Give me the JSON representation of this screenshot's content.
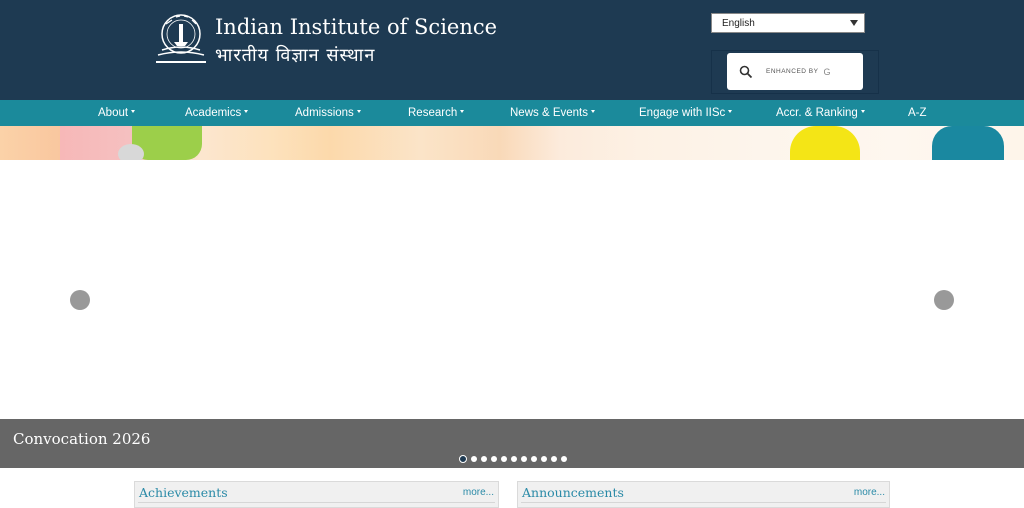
{
  "header": {
    "title_en": "Indian Institute of Science",
    "title_hi": "भारतीय  विज्ञान  संस्थान",
    "logo_icon": "iisc-logo-icon"
  },
  "language": {
    "selected": "English"
  },
  "search": {
    "enhanced_label": "ENHANCED BY",
    "g_glyph": "G"
  },
  "nav": {
    "items": [
      {
        "label": "About",
        "has_caret": true
      },
      {
        "label": "Academics",
        "has_caret": true
      },
      {
        "label": "Admissions",
        "has_caret": true
      },
      {
        "label": "Research",
        "has_caret": true
      },
      {
        "label": "News & Events",
        "has_caret": true
      },
      {
        "label": "Engage with IISc",
        "has_caret": true
      },
      {
        "label": "Accr. & Ranking",
        "has_caret": true
      },
      {
        "label": "A-Z",
        "has_caret": false
      }
    ]
  },
  "carousel": {
    "caption": "Convocation 2026",
    "slide_count": 11,
    "active_slide": 1
  },
  "panels": {
    "achievements": {
      "title": "Achievements",
      "more": "more..."
    },
    "announcements": {
      "title": "Announcements",
      "more": "more..."
    }
  },
  "colors": {
    "header_bg": "#1e3a52",
    "nav_bg": "#1b8a9b",
    "caption_bg": "#666666",
    "panel_title": "#2a8aa7"
  }
}
